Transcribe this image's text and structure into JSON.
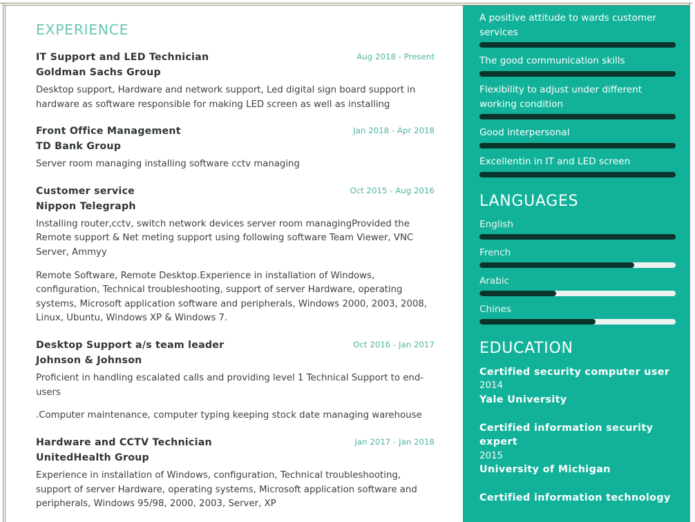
{
  "theme": {
    "accent_teal": "#12b29a",
    "heading_mint": "#6cc6b4",
    "date_teal": "#4cb3a2",
    "bar_dark": "#0b342b",
    "bar_track": "#eef3f1",
    "body_text": "#3b4044",
    "frame_olive": "#8b8b72"
  },
  "experience": {
    "title": "EXPERIENCE",
    "jobs": [
      {
        "title": "IT Support and LED Technician",
        "company": "Goldman Sachs Group",
        "date": "Aug 2018 - Present",
        "paragraphs": [
          "Desktop support, Hardware and network support, Led digital sign board support in hardware as software responsible for making LED screen as well as installing"
        ]
      },
      {
        "title": "Front Office Management",
        "company": "TD Bank Group",
        "date": "Jan 2018 - Apr 2018",
        "paragraphs": [
          "Server room managing installing software cctv managing"
        ]
      },
      {
        "title": "Customer service",
        "company": "Nippon Telegraph",
        "date": "Oct 2015 - Aug 2016",
        "paragraphs": [
          "Installing router,cctv, switch network devices server room managingProvided the Remote support & Net meting support using following software Team Viewer, VNC Server, Ammyy",
          "Remote Software, Remote Desktop.Experience in installation of Windows, configuration, Technical troubleshooting, support of server Hardware, operating systems, Microsoft application software and peripherals, Windows 2000, 2003, 2008, Linux, Ubuntu, Windows XP & Windows 7."
        ]
      },
      {
        "title": "Desktop Support a/s team leader",
        "company": "Johnson & Johnson",
        "date": "Oct 2016 - Jan 2017",
        "paragraphs": [
          "Proficient in handling escalated calls and providing level 1 Technical Support to end-users",
          ".Computer maintenance, computer typing keeping stock date managing warehouse"
        ]
      },
      {
        "title": "Hardware and CCTV Technician",
        "company": "UnitedHealth Group",
        "date": "Jan 2017 - Jan 2018",
        "paragraphs": [
          "Experience in installation of Windows, configuration, Technical troubleshooting, support of server Hardware, operating systems, Microsoft application software and peripherals, Windows 95/98, 2000, 2003, Server, XP"
        ]
      }
    ]
  },
  "skills": {
    "items": [
      {
        "label": "A positive attitude to wards customer services",
        "level": 100
      },
      {
        "label": "The good communication skills",
        "level": 100
      },
      {
        "label": "Flexibility to adjust under different working condition",
        "level": 100
      },
      {
        "label": "Good interpersonal",
        "level": 100
      },
      {
        "label": "Excellentin in IT and LED screen",
        "level": 100
      }
    ]
  },
  "languages": {
    "title": "LANGUAGES",
    "items": [
      {
        "label": "English",
        "level": 100
      },
      {
        "label": "French",
        "level": 79
      },
      {
        "label": "Arabic",
        "level": 39
      },
      {
        "label": "Chines",
        "level": 59
      }
    ]
  },
  "education": {
    "title": "EDUCATION",
    "items": [
      {
        "degree": "Certified security computer user",
        "year": "2014",
        "school": "Yale University"
      },
      {
        "degree": "Certified information security expert",
        "year": "2015",
        "school": "University of Michigan"
      },
      {
        "degree": "Certified information technology",
        "year": "",
        "school": ""
      }
    ]
  }
}
